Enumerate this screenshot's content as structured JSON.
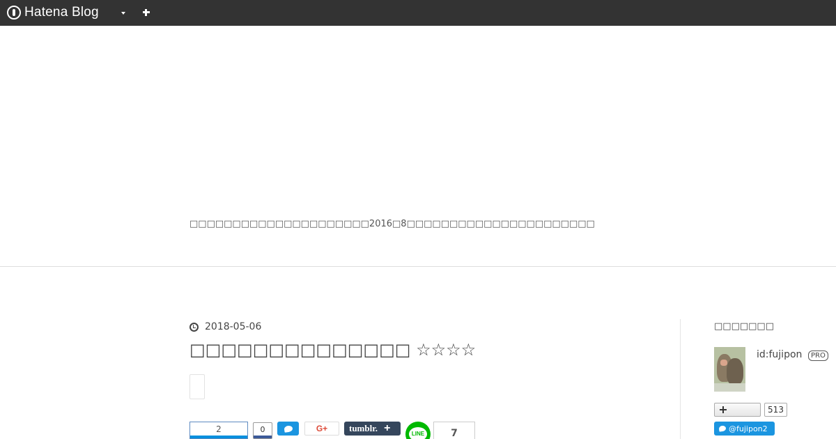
{
  "topbar": {
    "logo_text": "Hatena Blog",
    "menu_icon": "caret-down-icon",
    "add_icon": "plus-icon"
  },
  "header": {
    "description": "□□□□□□□□□□□□□□□□□□□□□2016□8□□□□□□□□□□□□□□□□□□□□□□"
  },
  "article": {
    "date": "2018-05-06",
    "title": "□□□□□□□□□□□□□□ ☆☆☆☆",
    "share": {
      "hatebu_count": "2",
      "facebook_count": "0",
      "gplus_label": "G+",
      "tumblr_label": "tumblr.",
      "tumblr_plus": "+",
      "line_label": "LINE",
      "pocket_count": "7"
    }
  },
  "sidebar": {
    "heading": "□□□□□□□",
    "user_id": "id:fujipon",
    "pro_badge": "PRO",
    "follower_count": "513",
    "twitter_handle": "@fujipon2"
  },
  "colors": {
    "topbar_bg": "#333333",
    "twitter_blue": "#1b95e0",
    "tumblr_navy": "#35465c",
    "line_green": "#00b900",
    "hatebu_blue": "#008fde"
  }
}
